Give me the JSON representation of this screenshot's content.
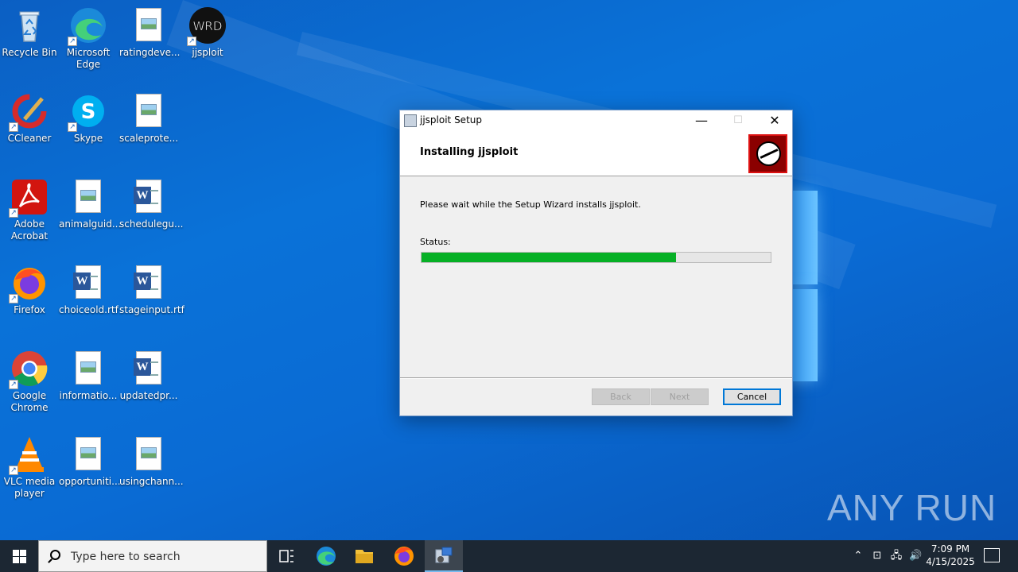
{
  "desktop": {
    "icons": [
      {
        "label": "Recycle Bin",
        "icon": "recycle-bin-icon"
      },
      {
        "label": "Microsoft Edge",
        "icon": "edge-icon"
      },
      {
        "label": "ratingdeve...",
        "icon": "image-file-icon"
      },
      {
        "label": "jjsploit",
        "icon": "jjsploit-icon"
      },
      {
        "label": "CCleaner",
        "icon": "ccleaner-icon"
      },
      {
        "label": "Skype",
        "icon": "skype-icon"
      },
      {
        "label": "scaleprote...",
        "icon": "image-file-icon"
      },
      {
        "label": "Adobe Acrobat",
        "icon": "acrobat-icon"
      },
      {
        "label": "animalguid...",
        "icon": "image-file-icon"
      },
      {
        "label": "schedulegu...",
        "icon": "word-file-icon"
      },
      {
        "label": "Firefox",
        "icon": "firefox-icon"
      },
      {
        "label": "choiceold.rtf",
        "icon": "word-file-icon"
      },
      {
        "label": "stageinput.rtf",
        "icon": "word-file-icon"
      },
      {
        "label": "Google Chrome",
        "icon": "chrome-icon"
      },
      {
        "label": "informatio...",
        "icon": "image-file-icon"
      },
      {
        "label": "updatedpr...",
        "icon": "word-file-icon"
      },
      {
        "label": "VLC media player",
        "icon": "vlc-icon"
      },
      {
        "label": "opportuniti...",
        "icon": "image-file-icon"
      },
      {
        "label": "usingchann...",
        "icon": "image-file-icon"
      }
    ],
    "watermark": "ANY RUN"
  },
  "dialog": {
    "title": "jjsploit Setup",
    "heading": "Installing jjsploit",
    "message": "Please wait while the Setup Wizard installs jjsploit.",
    "status_label": "Status:",
    "progress": 0.73,
    "buttons": {
      "back": "Back",
      "next": "Next",
      "cancel": "Cancel"
    },
    "window_controls": {
      "minimize": "—",
      "maximize": "☐",
      "close": "✕"
    }
  },
  "taskbar": {
    "search_placeholder": "Type here to search",
    "apps": [
      "task-view-icon",
      "edge-icon",
      "file-explorer-icon",
      "firefox-icon",
      "installer-icon"
    ],
    "clock_time": "7:09 PM",
    "clock_date": "4/15/2025"
  },
  "colors": {
    "progress": "#06b025",
    "accent": "#0078d7"
  }
}
